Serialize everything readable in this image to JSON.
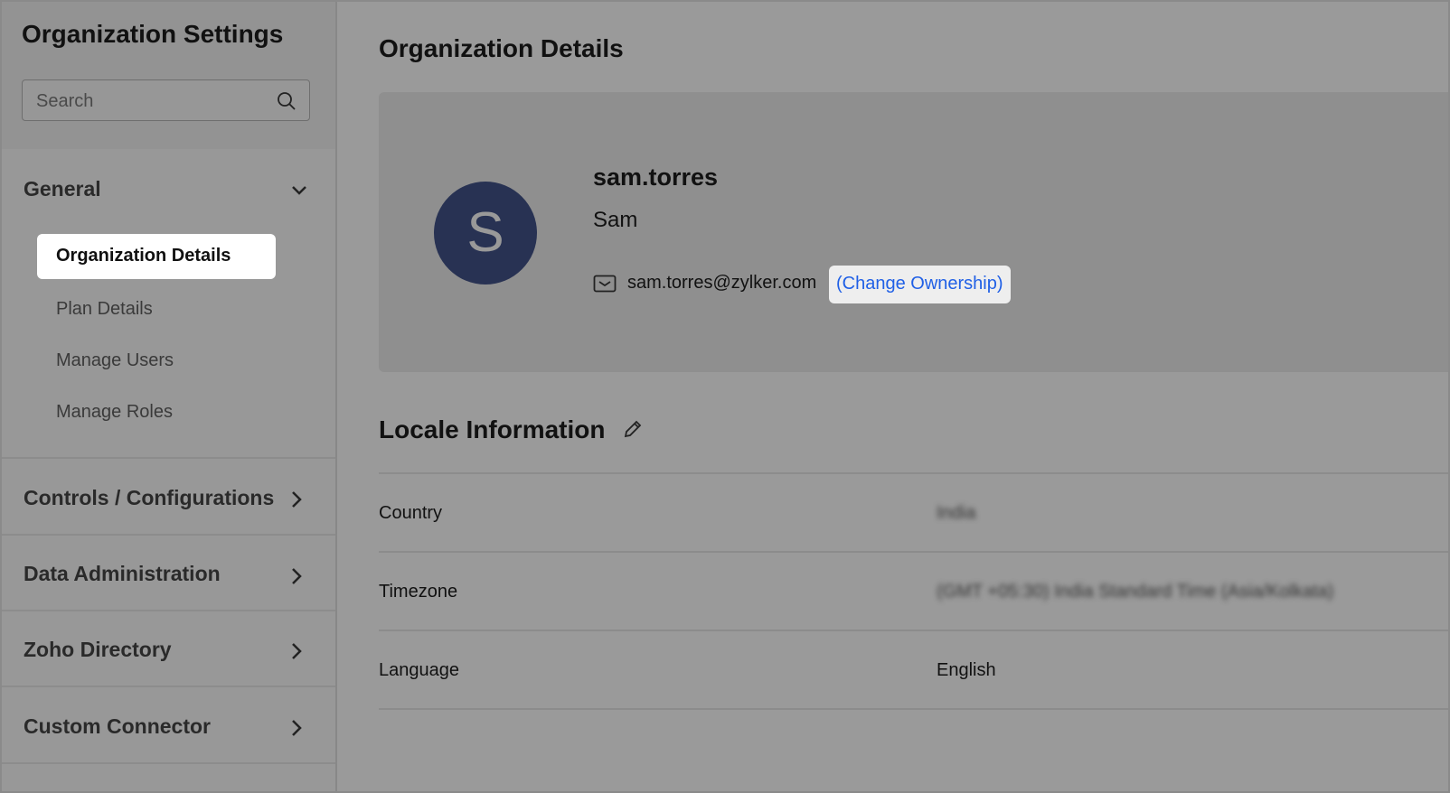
{
  "sidebar": {
    "title": "Organization Settings",
    "search_placeholder": "Search",
    "general": {
      "label": "General",
      "items": [
        {
          "label": "Organization Details",
          "active": true
        },
        {
          "label": "Plan Details"
        },
        {
          "label": "Manage Users"
        },
        {
          "label": "Manage Roles"
        }
      ]
    },
    "sections": [
      {
        "label": "Controls / Configurations"
      },
      {
        "label": "Data Administration"
      },
      {
        "label": "Zoho Directory"
      },
      {
        "label": "Custom Connector"
      }
    ]
  },
  "main": {
    "title": "Organization Details",
    "profile": {
      "initial": "S",
      "username": "sam.torres",
      "name": "Sam",
      "email": "sam.torres@zylker.com",
      "change_ownership": "(Change Ownership)"
    },
    "locale": {
      "title": "Locale Information",
      "rows": [
        {
          "label": "Country",
          "value": "India",
          "blurred": true
        },
        {
          "label": "Timezone",
          "value": "(GMT +05:30) India Standard Time (Asia/Kolkata)",
          "blurred": true
        },
        {
          "label": "Language",
          "value": "English",
          "blurred": false
        }
      ]
    }
  },
  "colors": {
    "avatar": "#283253",
    "link": "#2060e6"
  }
}
